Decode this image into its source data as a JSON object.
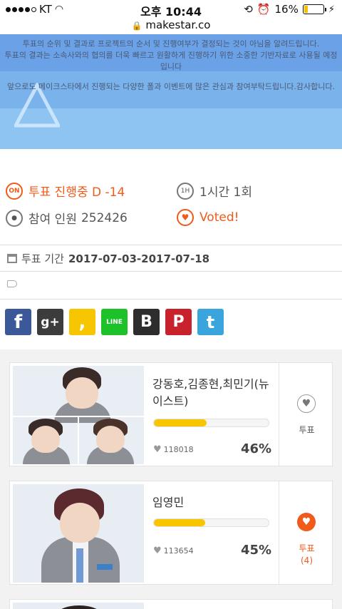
{
  "status_bar": {
    "carrier": "KT",
    "time": "오후 10:44",
    "battery": "16%"
  },
  "url": "makestar.co",
  "banner": {
    "line1": "투표의 순위 및 결과로 프로젝트의 순서 및 진행여부가 결정되는 것이 아님을 알려드립니다.",
    "line2": "투표의 결과는 소속사와의 협의를 더욱 빠르고 원활하게 진행하기 위한 소중한 기반자료로 사용될 예정입니다",
    "line3": "앞으로도 메이크스타에서 진행되는 다양한 폴과 이벤트에 많은 관심과 참여부탁드립니다.감사합니다."
  },
  "vote_info": {
    "on_badge": "ON",
    "status": "투표 진행중 D -14",
    "limit_badge": "1H",
    "limit": "1시간 1회",
    "participants_label": "참여 인원",
    "participants": "252426",
    "voted": "Voted!",
    "period_label": "투표 기간",
    "period": "2017-07-03-2017-07-18"
  },
  "social": [
    {
      "name": "facebook",
      "glyph": "f",
      "color": "#3b5998"
    },
    {
      "name": "google-plus",
      "glyph": "g+",
      "color": "#3c3c3c"
    },
    {
      "name": "kakaostory",
      "glyph": ",",
      "color": "#f7c600"
    },
    {
      "name": "line",
      "glyph": "LINE",
      "color": "#1dc22b"
    },
    {
      "name": "band",
      "glyph": "B",
      "color": "#2d2d2d"
    },
    {
      "name": "pinterest",
      "glyph": "P",
      "color": "#c8232c"
    },
    {
      "name": "twitter",
      "glyph": "t",
      "color": "#3aa4dd"
    }
  ],
  "candidates": [
    {
      "name": "강동호,김종현,최민기(뉴이스트)",
      "votes": "118018",
      "percent": "46%",
      "fill": 0.46,
      "vote_label": "투표",
      "vote_count": "",
      "voted": false
    },
    {
      "name": "임영민",
      "votes": "113654",
      "percent": "45%",
      "fill": 0.45,
      "vote_label": "투표",
      "vote_count": "(4)",
      "voted": true
    }
  ],
  "colors": {
    "accent": "#f05a1a",
    "bar": "#f7c600",
    "banner": "#8ec4f2"
  }
}
